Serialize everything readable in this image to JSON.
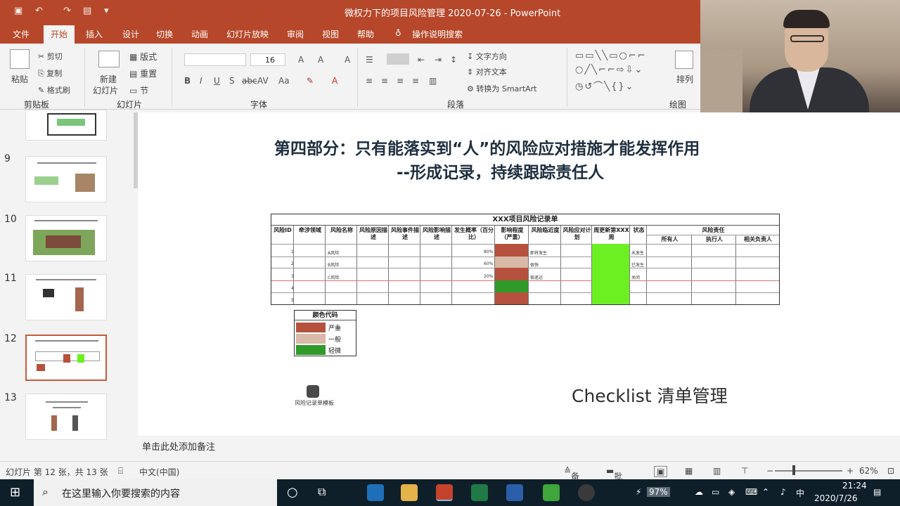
{
  "window": {
    "title": "微权力下的项目风险管理 2020-07-26 - PowerPoint"
  },
  "ribbon": {
    "tabs": [
      "文件",
      "开始",
      "插入",
      "设计",
      "切换",
      "动画",
      "幻灯片放映",
      "审阅",
      "视图",
      "帮助"
    ],
    "tell_me": "操作说明搜索",
    "clipboard": {
      "paste": "粘贴",
      "cut": "剪切",
      "copy": "复制",
      "format_painter": "格式刷",
      "label": "剪贴板"
    },
    "slides": {
      "new_slide": "新建",
      "new_slide2": "幻灯片",
      "layout": "版式",
      "reset": "重置",
      "section": "节",
      "label": "幻灯片"
    },
    "font": {
      "size": "16",
      "label": "字体"
    },
    "paragraph": {
      "text_direction": "文字方向",
      "align_text": "对齐文本",
      "smartart": "转换为 SmartArt",
      "label": "段落"
    },
    "drawing": {
      "arrange": "排列",
      "label": "绘图"
    }
  },
  "thumbnails": [
    {
      "num": "9"
    },
    {
      "num": "10"
    },
    {
      "num": "11"
    },
    {
      "num": "12"
    },
    {
      "num": "13"
    }
  ],
  "slide": {
    "title_line1": "第四部分：只有能落实到“人”的风险应对措施才能发挥作用",
    "title_line2": "--形成记录，持续跟踪责任人",
    "table": {
      "title": "XXX项目风险记录单",
      "headers": [
        "风险ID",
        "牵涉领域",
        "风险名称",
        "风险原因描述",
        "风险事件描述",
        "风险影响描述",
        "发生概率（百分比）",
        "影响程度（严重）",
        "风险临近度",
        "风险应对计划",
        "周更新第XXX周",
        "状态",
        "风险责任"
      ],
      "sub_headers": [
        "所有人",
        "执行人",
        "相关负责人"
      ],
      "rows": [
        {
          "id": "1",
          "name": "A风险",
          "prob": "80%",
          "near": "即将发生",
          "status": "未发生"
        },
        {
          "id": "2",
          "name": "B风险",
          "prob": "60%",
          "near": "很快",
          "status": "已发生"
        },
        {
          "id": "3",
          "name": "C风险",
          "prob": "20%",
          "near": "很遥远",
          "status": "关闭"
        },
        {
          "id": "4",
          "name": "",
          "prob": "",
          "near": "",
          "status": ""
        },
        {
          "id": "5",
          "name": "",
          "prob": "",
          "near": "",
          "status": ""
        }
      ]
    },
    "legend": {
      "title": "颜色代码",
      "items": [
        {
          "label": "严重",
          "color": "#b5513d"
        },
        {
          "label": "一般",
          "color": "#d9b9a8"
        },
        {
          "label": "轻微",
          "color": "#2f9a2a"
        }
      ]
    },
    "embedded_file": "风险记录单模板",
    "checklist": "Checklist 清单管理"
  },
  "notes": {
    "placeholder": "单击此处添加备注"
  },
  "status": {
    "slide_info": "幻灯片 第 12 张，共 13 张",
    "language": "中文(中国)",
    "notes_btn": "备注",
    "comments_btn": "批注",
    "zoom": "62%"
  },
  "taskbar": {
    "search_placeholder": "在这里输入你要搜索的内容",
    "battery": "97%",
    "ime": "中",
    "time": "21:24",
    "date": "2020/7/26"
  },
  "colors": {
    "accent": "#b7472a",
    "severe": "#b5513d",
    "green": "#6df022"
  }
}
